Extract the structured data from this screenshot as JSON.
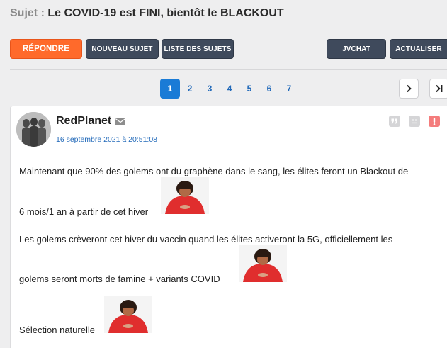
{
  "topic": {
    "prefix": "Sujet :",
    "title": "Le COVID-19 est FINI, bientôt le BLACKOUT"
  },
  "toolbar": {
    "reply": "RÉPONDRE",
    "new_topic": "NOUVEAU SUJET",
    "topic_list": "LISTE DES SUJETS",
    "jvchat": "JVCHAT",
    "refresh": "ACTUALISER"
  },
  "pagination": {
    "pages": [
      "1",
      "2",
      "3",
      "4",
      "5",
      "6",
      "7"
    ],
    "current": "1"
  },
  "icons": {
    "next": "chevron-right-icon",
    "last": "last-page-icon",
    "mail": "mail-icon",
    "quote": "quote-icon",
    "blacklist": "blacklist-icon",
    "report": "report-icon"
  },
  "colors": {
    "accent": "#ff6a2b",
    "dark_button": "#3f4a5c",
    "link": "#2169b9",
    "page_active": "#1a7bd6",
    "report": "#f47c7c"
  },
  "post": {
    "author": "RedPlanet",
    "date": "16 septembre 2021 à 20:51:08",
    "lines": [
      "Maintenant que 90% des golems ont du graphène dans le sang, les élites feront un Blackout de",
      "6 mois/1 an à partir de cet hiver",
      "Les golems crèveront cet hiver du vaccin quand les élites activeront la 5G, officiellement les",
      "golems seront morts de famine + variants COVID",
      "Sélection naturelle"
    ]
  }
}
